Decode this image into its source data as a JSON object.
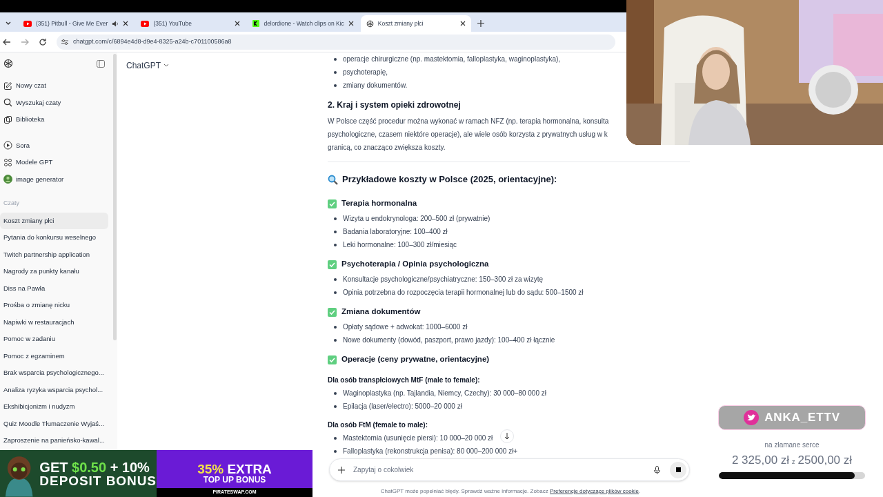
{
  "browser": {
    "tabs": [
      {
        "title": "(351) Pitbull - Give Me Ever",
        "kind": "video",
        "audio": true,
        "selected": false
      },
      {
        "title": "(351) YouTube",
        "kind": "video",
        "audio": false,
        "selected": false
      },
      {
        "title": "delordione - Watch clips on Kic",
        "kind": "clips",
        "audio": false,
        "selected": false
      },
      {
        "title": "Koszt zmiany płci",
        "kind": "chat",
        "audio": false,
        "selected": true
      }
    ],
    "url": "chatgpt.com/c/6894e4d8-d9e4-8325-a24b-c701100586a8"
  },
  "sidebar": {
    "nav": [
      {
        "label": "Nowy czat",
        "kind": "edit"
      },
      {
        "label": "Wyszukaj czaty",
        "kind": "search"
      },
      {
        "label": "Biblioteka",
        "kind": "library"
      }
    ],
    "tools": [
      {
        "label": "Sora",
        "kind": "play"
      },
      {
        "label": "Modele GPT",
        "kind": "grid"
      },
      {
        "label": "image generator",
        "kind": "avatar"
      }
    ],
    "section": "Czaty",
    "chats": [
      {
        "label": "Koszt zmiany płci",
        "selected": true
      },
      {
        "label": "Pytania do konkursu weselnego",
        "selected": false
      },
      {
        "label": "Twitch partnership application",
        "selected": false
      },
      {
        "label": "Nagrody za punkty kanału",
        "selected": false
      },
      {
        "label": "Diss na Pawła",
        "selected": false
      },
      {
        "label": "Prośba o zmianę nicku",
        "selected": false
      },
      {
        "label": "Napiwki w restauracjach",
        "selected": false
      },
      {
        "label": "Pomoc w zadaniu",
        "selected": false
      },
      {
        "label": "Pomoc z egzaminem",
        "selected": false
      },
      {
        "label": "Brak wsparcia psychologicznego...",
        "selected": false
      },
      {
        "label": "Analiza ryzyka wsparcia psychol...",
        "selected": false
      },
      {
        "label": "Ekshibicjonizm i nudyzm",
        "selected": false
      },
      {
        "label": "Quiz Moodle Tłumaczenie Wyjaś...",
        "selected": false
      },
      {
        "label": "Zaproszenie na panieńsko-kawal...",
        "selected": false
      }
    ]
  },
  "header": {
    "model": "ChatGPT"
  },
  "content": [
    {
      "kind": "bullet",
      "text": "operacje chirurgiczne (np. mastektomia, falloplastyka, waginoplastyka),"
    },
    {
      "kind": "bullet",
      "text": "psychoterapię,"
    },
    {
      "kind": "bullet",
      "text": "zmiany dokumentów."
    },
    {
      "kind": "heading",
      "text": "2. Kraj i system opieki zdrowotnej"
    },
    {
      "kind": "line",
      "text": "W Polsce część procedur można wykonać w ramach NFZ (np. terapia hormonalna, konsulta"
    },
    {
      "kind": "line",
      "text": "psychologiczne, czasem niektóre operacje), ale wiele osób korzysta z prywatnych usług w k"
    },
    {
      "kind": "line",
      "text": "granicą, co znacząco zwiększa koszty."
    },
    {
      "kind": "divider"
    },
    {
      "kind": "title",
      "text": "Przykładowe koszty w Polsce (2025, orientacyjne):"
    },
    {
      "kind": "section",
      "text": "Terapia hormonalna"
    },
    {
      "kind": "bullet",
      "text": "Wizyta u endokrynologa: 200–500 zł (prywatnie)"
    },
    {
      "kind": "bullet",
      "text": "Badania laboratoryjne: 100–400 zł"
    },
    {
      "kind": "bullet",
      "text": "Leki hormonalne: 100–300 zł/miesiąc"
    },
    {
      "kind": "section",
      "text": "Psychoterapia / Opinia psychologiczna"
    },
    {
      "kind": "bullet",
      "text": "Konsultacje psychologiczne/psychiatryczne: 150–300 zł za wizytę"
    },
    {
      "kind": "bullet",
      "text": "Opinia potrzebna do rozpoczęcia terapii hormonalnej lub do sądu: 500–1500 zł"
    },
    {
      "kind": "section",
      "text": "Zmiana dokumentów"
    },
    {
      "kind": "bullet",
      "text": "Opłaty sądowe + adwokat: 1000–6000 zł"
    },
    {
      "kind": "bullet",
      "text": "Nowe dokumenty (dowód, paszport, prawo jazdy): 100–400 zł łącznie"
    },
    {
      "kind": "section",
      "text": "Operacje (ceny prywatne, orientacyjne)"
    },
    {
      "kind": "sub",
      "text": "Dla osób transpłciowych MtF (male to female):"
    },
    {
      "kind": "bullet",
      "text": "Waginoplastyka (np. Tajlandia, Niemcy, Czechy): 30 000–80 000 zł"
    },
    {
      "kind": "bullet",
      "text": "Epilacja (laser/electro): 5000–20 000 zł"
    },
    {
      "kind": "sub",
      "text": "Dla osób FtM (female to male):"
    },
    {
      "kind": "bullet",
      "text": "Mastektomia (usunięcie piersi): 10 000–20 000 zł"
    },
    {
      "kind": "bullet",
      "text": "Falloplastyka (rekonstrukcja penisa): 80 000–200 000 zł+"
    }
  ],
  "composer": {
    "placeholder": "Zapytaj o cokolwiek"
  },
  "footer": {
    "text": "ChatGPT może popełniać błędy. Sprawdź ważne informacje. Zobacz",
    "link": "Preferencje dotyczące plików cookie",
    "end": "."
  },
  "ads": [
    {
      "line1": "GET",
      "accent": "$0.50",
      "line1b": "+ 10%",
      "line2": "DEPOSIT BONUS"
    },
    {
      "accent": "35%",
      "line1b": "EXTRA",
      "line2": "TOP UP BONUS",
      "site": "PIRATESWAP.COM"
    }
  ],
  "overlay": {
    "handle": "ANKA_ETTV",
    "goal": "na złamane serce",
    "raised": "2 325,00 zł",
    "sep": "z",
    "target": "2500,00 zł",
    "level": 0.93
  }
}
